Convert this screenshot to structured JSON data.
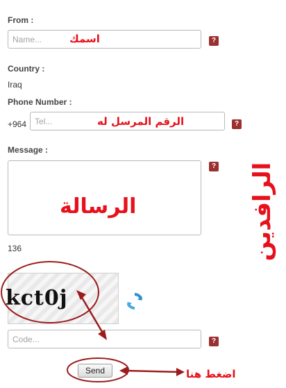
{
  "form": {
    "from_label": "From :",
    "name_placeholder": "Name...",
    "country_label": "Country :",
    "country_value": "Iraq",
    "phone_label": "Phone Number :",
    "phone_prefix": "+964",
    "tel_placeholder": "Tel...",
    "message_label": "Message :",
    "char_count": "136",
    "captcha_text": "kct0j",
    "code_placeholder": "Code...",
    "send_label": "Send",
    "help_icon_text": "?"
  },
  "annotations": {
    "name_hint": "اسمك",
    "phone_hint": "الرقم المرسل له",
    "message_hint": "الرسالة",
    "click_hint": "اضغط هنا",
    "watermark": "الرافدين"
  },
  "colors": {
    "annotation_red": "#e8101a",
    "help_badge": "#9b3030"
  }
}
